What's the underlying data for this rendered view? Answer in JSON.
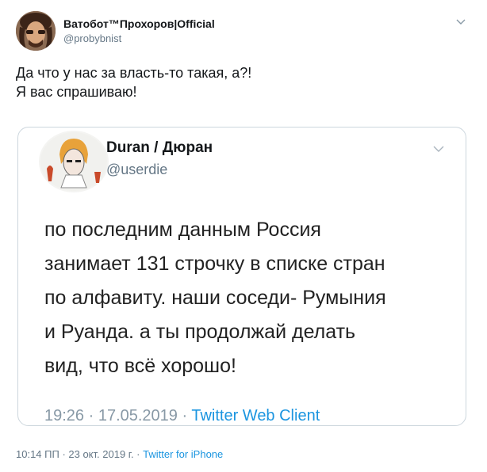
{
  "tweet": {
    "author_name": "Ватобот™Прохоров|Official",
    "author_handle": "@probybnist",
    "text_lines": [
      "Да что у нас за власть-то такая, а?!",
      "Я вас спрашиваю!"
    ],
    "date_part": "10:14 ПП · 23 окт. 2019 г. · ",
    "source": "Twitter for iPhone",
    "menu_icon": "chevron-down-icon"
  },
  "quote": {
    "author_name": "Duran / Дюран",
    "author_handle": "@userdie",
    "text_lines": [
      "по последним данным Россия",
      "занимает 131 строчку в списке стран",
      "по алфавиту. наши соседи- Румыния",
      "и Руанда. а ты продолжай делать",
      "вид, что всё хорошо!"
    ],
    "time_part": "19:26 · 17.05.2019 · ",
    "source": "Twitter Web Client",
    "menu_icon": "chevron-down-icon"
  },
  "colors": {
    "link": "#1b95e0",
    "muted": "#657786",
    "border": "#ccd6dd"
  }
}
